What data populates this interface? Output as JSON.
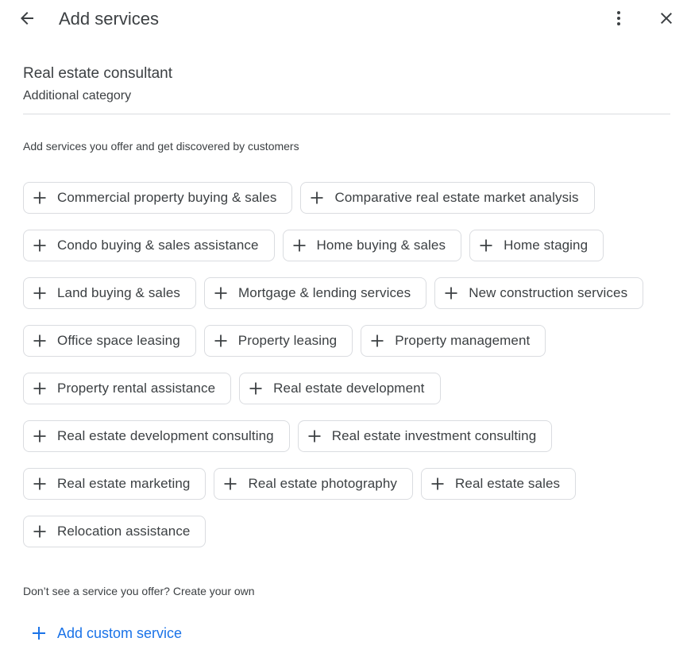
{
  "header": {
    "title": "Add services",
    "back_icon": "arrow-left-icon",
    "more_icon": "more-vert-icon",
    "close_icon": "close-icon"
  },
  "category": {
    "name": "Real estate consultant",
    "type": "Additional category"
  },
  "intro_text": "Add services you offer and get discovered by customers",
  "services": [
    "Commercial property buying & sales",
    "Comparative real estate market analysis",
    "Condo buying & sales assistance",
    "Home buying & sales",
    "Home staging",
    "Land buying & sales",
    "Mortgage & lending services",
    "New construction services",
    "Office space leasing",
    "Property leasing",
    "Property management",
    "Property rental assistance",
    "Real estate development",
    "Real estate development consulting",
    "Real estate investment consulting",
    "Real estate marketing",
    "Real estate photography",
    "Real estate sales",
    "Relocation assistance"
  ],
  "custom": {
    "prompt": "Don’t see a service you offer? Create your own",
    "add_label": "Add custom service"
  },
  "colors": {
    "accent": "#1a73e8",
    "text": "#3c4043",
    "border": "#dadce0"
  }
}
